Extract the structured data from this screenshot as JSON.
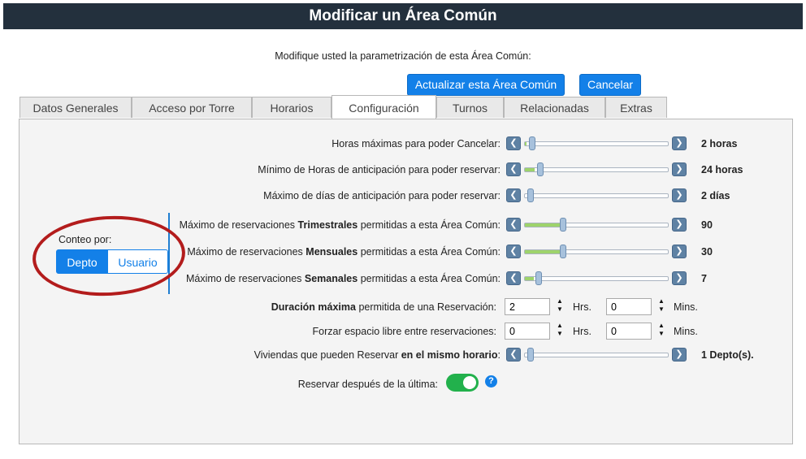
{
  "title": "Modificar un Área Común",
  "subtitle": "Modifique usted la parametrización de esta Área Común:",
  "buttons": {
    "update": "Actualizar esta Área Común",
    "cancel": "Cancelar"
  },
  "tabs": [
    "Datos Generales",
    "Acceso por Torre",
    "Horarios",
    "Configuración",
    "Turnos",
    "Relacionadas",
    "Extras"
  ],
  "active_tab": "Configuración",
  "sliders": [
    {
      "pre": "Horas máximas para poder Cancelar:",
      "bold": "",
      "post": "",
      "value": "2 horas",
      "fraction": 0.01
    },
    {
      "pre": "Mínimo de Horas de anticipación para poder reservar:",
      "bold": "",
      "post": "",
      "value": "24 horas",
      "fraction": 0.07
    },
    {
      "pre": "Máximo de días de anticipación para poder reservar:",
      "bold": "",
      "post": "",
      "value": "2 días",
      "fraction": 0.0
    },
    {
      "pre": "Máximo de reservaciones ",
      "bold": "Trimestrales",
      "post": " permitidas a esta Área Común:",
      "value": "90",
      "fraction": 0.24
    },
    {
      "pre": "Máximo de reservaciones ",
      "bold": "Mensuales",
      "post": " permitidas a esta Área Común:",
      "value": "30",
      "fraction": 0.24
    },
    {
      "pre": "Máximo de reservaciones ",
      "bold": "Semanales",
      "post": " permitidas a esta Área Común:",
      "value": "7",
      "fraction": 0.06
    }
  ],
  "duracion": {
    "label_bold": "Duración máxima",
    "label_rest": " permitida de una Reservación:",
    "hrs": "2",
    "mins": "0"
  },
  "forzar": {
    "label": "Forzar espacio libre entre reservaciones:",
    "hrs": "0",
    "mins": "0"
  },
  "units": {
    "hrs": "Hrs.",
    "mins": "Mins."
  },
  "viviendas": {
    "pre": "Viviendas que pueden Reservar ",
    "bold": "en el mismo horario",
    "post": ":",
    "value": "1 Depto(s).",
    "fraction": 0.0
  },
  "reservar_despues": {
    "label": "Reservar después de la última:",
    "on": true
  },
  "conteo": {
    "label": "Conteo por:",
    "options": [
      "Depto",
      "Usuario"
    ],
    "selected": "Depto"
  },
  "colors": {
    "titlebar": "#23303d",
    "primary": "#1380e8",
    "slider_fill": "#9ed36b",
    "annotation": "#b31c1c",
    "toggle": "#22b14c"
  },
  "icons": {
    "slider_left": "chevron-left-icon",
    "slider_right": "chevron-right-icon",
    "spinner": "up-down-arrows-icon",
    "help": "question-circle-icon"
  }
}
